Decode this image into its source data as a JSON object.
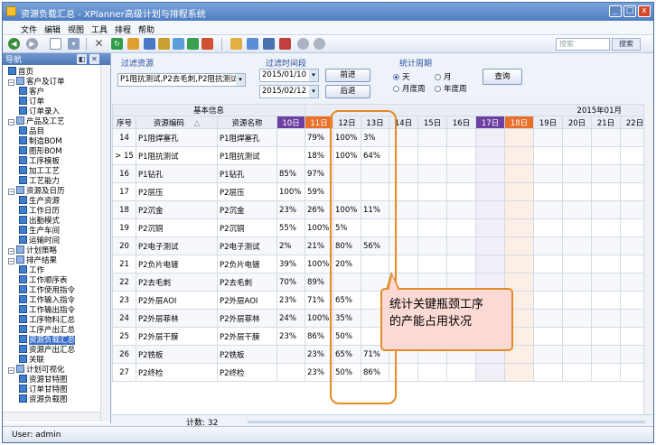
{
  "window": {
    "title": "资源负载汇总 - XPlanner高级计划与排程系统",
    "min": "_",
    "max": "□",
    "close": "x"
  },
  "menu": [
    "文件",
    "编辑",
    "视图",
    "工具",
    "排程",
    "帮助"
  ],
  "toolbar": {
    "search_placeholder": "搜索",
    "search_btn": "搜索"
  },
  "sidebar": {
    "title": "导航",
    "items": [
      {
        "label": "首页",
        "level": 0,
        "type": "leaf"
      },
      {
        "label": "客户及订单",
        "level": 0,
        "type": "folder"
      },
      {
        "label": "客户",
        "level": 1,
        "type": "leaf"
      },
      {
        "label": "订单",
        "level": 1,
        "type": "leaf"
      },
      {
        "label": "订单录入",
        "level": 1,
        "type": "leaf"
      },
      {
        "label": "产品及工艺",
        "level": 0,
        "type": "folder"
      },
      {
        "label": "品目",
        "level": 1,
        "type": "leaf"
      },
      {
        "label": "制造BOM",
        "level": 1,
        "type": "leaf"
      },
      {
        "label": "图形BOM",
        "level": 1,
        "type": "leaf"
      },
      {
        "label": "工序模板",
        "level": 1,
        "type": "leaf"
      },
      {
        "label": "加工工艺",
        "level": 1,
        "type": "leaf"
      },
      {
        "label": "工艺能力",
        "level": 1,
        "type": "leaf"
      },
      {
        "label": "资源及日历",
        "level": 0,
        "type": "folder"
      },
      {
        "label": "生产资源",
        "level": 1,
        "type": "leaf"
      },
      {
        "label": "工作日历",
        "level": 1,
        "type": "leaf"
      },
      {
        "label": "出勤模式",
        "level": 1,
        "type": "leaf"
      },
      {
        "label": "生产车间",
        "level": 1,
        "type": "leaf"
      },
      {
        "label": "运输时间",
        "level": 1,
        "type": "leaf"
      },
      {
        "label": "计划策略",
        "level": 0,
        "type": "folder"
      },
      {
        "label": "排产结果",
        "level": 0,
        "type": "folder"
      },
      {
        "label": "工作",
        "level": 1,
        "type": "leaf"
      },
      {
        "label": "工作顺序表",
        "level": 1,
        "type": "leaf"
      },
      {
        "label": "工作使用指令",
        "level": 1,
        "type": "leaf"
      },
      {
        "label": "工作输入指令",
        "level": 1,
        "type": "leaf"
      },
      {
        "label": "工作输出指令",
        "level": 1,
        "type": "leaf"
      },
      {
        "label": "工序物料汇总",
        "level": 1,
        "type": "leaf"
      },
      {
        "label": "工序产出汇总",
        "level": 1,
        "type": "leaf"
      },
      {
        "label": "资源负载汇总",
        "level": 1,
        "type": "leaf",
        "selected": true
      },
      {
        "label": "资源产出汇总",
        "level": 1,
        "type": "leaf"
      },
      {
        "label": "关联",
        "level": 1,
        "type": "leaf"
      },
      {
        "label": "计划可视化",
        "level": 0,
        "type": "folder"
      },
      {
        "label": "资源甘特图",
        "level": 1,
        "type": "leaf"
      },
      {
        "label": "订单甘特图",
        "level": 1,
        "type": "leaf"
      },
      {
        "label": "资源负载图",
        "level": 1,
        "type": "leaf"
      }
    ]
  },
  "filter": {
    "resource_label": "过滤资源",
    "resource_value": "P1阻抗测试,P2去毛刺,P2阻抗测试,P2阻抗测试...",
    "time_label": "过滤时间段",
    "date_from": "2015/01/10",
    "date_to": "2015/02/12",
    "prev_btn": "前进",
    "next_btn": "后退",
    "period_label": "统计周期",
    "periods": [
      "天",
      "月",
      "月度周",
      "年度周"
    ],
    "query_btn": "查询"
  },
  "grid": {
    "group_header": "基本信息",
    "month_header": "2015年01月",
    "col_seq": "序号",
    "col_code": "资源编码",
    "sort_glyph": "△",
    "col_name": "资源名称",
    "days": [
      "10日",
      "11日",
      "12日",
      "13日",
      "14日",
      "15日",
      "16日",
      "17日",
      "18日",
      "19日",
      "20日",
      "21日",
      "22日"
    ],
    "rows": [
      {
        "seq": "14",
        "code": "P1阻焊塞孔",
        "name": "P1阻焊塞孔",
        "v": [
          "",
          "79%",
          "100%",
          "3%"
        ]
      },
      {
        "seq": "> 15",
        "code": "P1阻抗测试",
        "name": "P1阻抗测试",
        "v": [
          "",
          "18%",
          "100%",
          "64%"
        ]
      },
      {
        "seq": "16",
        "code": "P1钻孔",
        "name": "P1钻孔",
        "v": [
          "85%",
          "97%",
          "",
          ""
        ]
      },
      {
        "seq": "17",
        "code": "P2层压",
        "name": "P2层压",
        "v": [
          "100%",
          "59%",
          "",
          ""
        ]
      },
      {
        "seq": "18",
        "code": "P2沉金",
        "name": "P2沉金",
        "v": [
          "23%",
          "26%",
          "100%",
          "11%"
        ]
      },
      {
        "seq": "19",
        "code": "P2沉铜",
        "name": "P2沉铜",
        "v": [
          "55%",
          "100%",
          "5%",
          ""
        ]
      },
      {
        "seq": "20",
        "code": "P2电子测试",
        "name": "P2电子测试",
        "v": [
          "2%",
          "21%",
          "80%",
          "56%"
        ]
      },
      {
        "seq": "21",
        "code": "P2负片电镀",
        "name": "P2负片电镀",
        "v": [
          "39%",
          "100%",
          "20%",
          ""
        ]
      },
      {
        "seq": "22",
        "code": "P2去毛刺",
        "name": "P2去毛刺",
        "v": [
          "70%",
          "89%",
          "",
          ""
        ]
      },
      {
        "seq": "23",
        "code": "P2外层AOI",
        "name": "P2外层AOI",
        "v": [
          "23%",
          "71%",
          "65%",
          ""
        ]
      },
      {
        "seq": "24",
        "code": "P2外层菲林",
        "name": "P2外层菲林",
        "v": [
          "24%",
          "100%",
          "35%",
          ""
        ]
      },
      {
        "seq": "25",
        "code": "P2外层干膜",
        "name": "P2外层干膜",
        "v": [
          "23%",
          "86%",
          "50%",
          ""
        ]
      },
      {
        "seq": "26",
        "code": "P2铣板",
        "name": "P2铣板",
        "v": [
          "",
          "23%",
          "65%",
          "71%"
        ]
      },
      {
        "seq": "27",
        "code": "P2终检",
        "name": "P2终检",
        "v": [
          "",
          "23%",
          "50%",
          "86%"
        ]
      }
    ],
    "count_label": "计数: 32"
  },
  "callout": {
    "line1": "统计关键瓶颈工序",
    "line2": "的产能占用状况"
  },
  "status": {
    "user": "User: admin"
  },
  "colors": {
    "purple_day": "#6d3fa0",
    "orange_day": "#e8702a",
    "highlight": "#e68a23"
  }
}
